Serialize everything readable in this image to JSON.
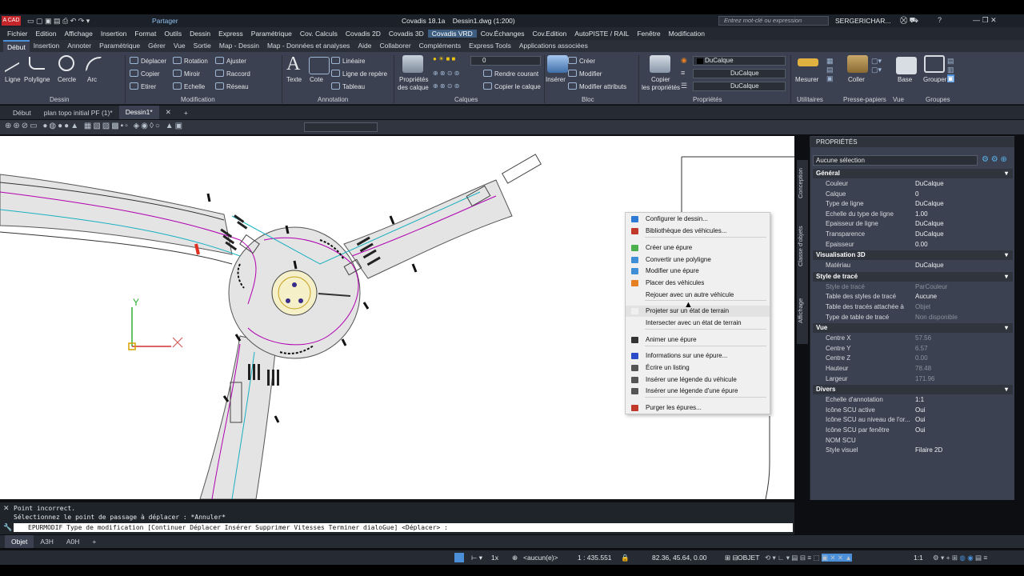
{
  "title": {
    "app_badge": "A CAD",
    "share": "Partager",
    "doc_title": "Covadis 18.1a    Dessin1.dwg (1:200)",
    "search_placeholder": "Entrez mot-clé ou expression",
    "user": "SERGERICHAR..."
  },
  "menubar": [
    "Fichier",
    "Edition",
    "Affichage",
    "Insertion",
    "Format",
    "Outils",
    "Dessin",
    "Express",
    "Paramétrique",
    "Cov. Calculs",
    "Covadis 2D",
    "Covadis 3D",
    "Covadis VRD",
    "Cov.Échanges",
    "Cov.Edition",
    "AutoPISTE / RAIL",
    "Fenêtre",
    "Modification"
  ],
  "menubar_active": "Covadis VRD",
  "ribbon_tabs": [
    "Début",
    "Insertion",
    "Annoter",
    "Paramétrique",
    "Gérer",
    "Vue",
    "Sortie",
    "Map - Dessin",
    "Map - Données et analyses",
    "Aide",
    "Collaborer",
    "Compléments",
    "Express Tools",
    "Applications associées"
  ],
  "ribbon": {
    "draw": [
      "Ligne",
      "Polyligne",
      "Cercle",
      "Arc"
    ],
    "draw_group": "Dessin",
    "modify": [
      "Déplacer",
      "Rotation",
      "Ajuster",
      "Copier",
      "Miroir",
      "Raccord",
      "Etirer",
      "Echelle",
      "Réseau"
    ],
    "modify_group": "Modification",
    "annot": [
      "Texte",
      "Cote",
      "Linéaire",
      "Ligne de repère",
      "Tableau"
    ],
    "annot_group": "Annotation",
    "layers": [
      "Propriétés",
      "des calque",
      "Rendre courant",
      "Copier le calque"
    ],
    "layer_value": "0",
    "layers_group": "Calques",
    "block": [
      "Insérer",
      "Créer",
      "Modifier",
      "Modifier attributs"
    ],
    "block_group": "Bloc",
    "props": [
      "Copier",
      "les propriétés",
      "DuCalque",
      "DuCalque",
      "DuCalque"
    ],
    "props_group": "Propriétés",
    "util": [
      "Mesurer",
      "Coller",
      "Base",
      "Grouper"
    ],
    "util_groups": [
      "Utilitaires",
      "Presse-papiers",
      "Vue",
      "Groupes"
    ]
  },
  "doc_tabs": [
    "Début",
    "plan topo initial PF (1)*",
    "Dessin1*"
  ],
  "ucs": {
    "y": "Y"
  },
  "context_menu": [
    {
      "label": "Configurer le dessin...",
      "icon": "config-icon",
      "color": "#2e7bd6"
    },
    {
      "label": "Bibliothèque des véhicules...",
      "icon": "vehicle-library-icon",
      "color": "#c0392b"
    },
    {
      "label": "Créer une épure",
      "icon": "create-path-icon",
      "color": "#4caf50"
    },
    {
      "label": "Convertir une polyligne",
      "icon": "convert-polyline-icon",
      "color": "#3f8fd6"
    },
    {
      "label": "Modifier une épure",
      "icon": "modify-path-icon",
      "color": "#3f8fd6"
    },
    {
      "label": "Placer des véhicules",
      "icon": "place-vehicles-icon",
      "color": "#e67e22"
    },
    {
      "label": "Rejouer avec un autre véhicule",
      "icon": "replay-icon",
      "color": "#f0f0f0"
    },
    {
      "label": "Projeter sur un état de terrain",
      "icon": "project-icon",
      "color": "#f0f0f0"
    },
    {
      "label": "Intersecter avec un état de terrain",
      "icon": "intersect-icon",
      "color": "#f0f0f0"
    },
    {
      "label": "Animer une épure",
      "icon": "animate-icon",
      "color": "#333333"
    },
    {
      "label": "Informations sur une épure...",
      "icon": "info-icon",
      "color": "#2b4cc8"
    },
    {
      "label": "Écrire un listing",
      "icon": "listing-icon",
      "color": "#555555"
    },
    {
      "label": "Insérer une légende du véhicule",
      "icon": "vehicle-legend-icon",
      "color": "#555555"
    },
    {
      "label": "Insérer une légende d'une épure",
      "icon": "path-legend-icon",
      "color": "#555555"
    },
    {
      "label": "Purger les épures...",
      "icon": "purge-icon",
      "color": "#c0392b"
    }
  ],
  "properties": {
    "title": "PROPRIÉTÉS",
    "selection": "Aucune sélection",
    "side_tabs": [
      "Conception",
      "Classe d'objets",
      "Affichage"
    ],
    "sections": [
      {
        "name": "Général",
        "rows": [
          [
            "Couleur",
            "DuCalque"
          ],
          [
            "Calque",
            "0"
          ],
          [
            "Type de ligne",
            "DuCalque"
          ],
          [
            "Echelle du type de ligne",
            "1.00"
          ],
          [
            "Epaisseur de ligne",
            "DuCalque"
          ],
          [
            "Transparence",
            "DuCalque"
          ],
          [
            "Epaisseur",
            "0.00"
          ]
        ]
      },
      {
        "name": "Visualisation 3D",
        "rows": [
          [
            "Matériau",
            "DuCalque"
          ]
        ]
      },
      {
        "name": "Style de tracé",
        "rows": [
          [
            "Style de tracé",
            "ParCouleur"
          ],
          [
            "Table des styles de tracé",
            "Aucune"
          ],
          [
            "Table des tracés attachée à",
            "Objet"
          ],
          [
            "Type de table de tracé",
            "Non disponible"
          ]
        ]
      },
      {
        "name": "Vue",
        "rows": [
          [
            "Centre X",
            "57.56"
          ],
          [
            "Centre Y",
            "6.57"
          ],
          [
            "Centre Z",
            "0.00"
          ],
          [
            "Hauteur",
            "78.48"
          ],
          [
            "Largeur",
            "171.96"
          ]
        ]
      },
      {
        "name": "Divers",
        "rows": [
          [
            "Echelle d'annotation",
            "1:1"
          ],
          [
            "Icône SCU active",
            "Oui"
          ],
          [
            "Icône SCU au niveau de l'or...",
            "Oui"
          ],
          [
            "Icône SCU par fenêtre",
            "Oui"
          ],
          [
            "NOM SCU",
            ""
          ],
          [
            "Style visuel",
            "Filaire 2D"
          ]
        ]
      }
    ]
  },
  "command": {
    "line1": "Point incorrect.",
    "line2": "Sélectionnez le point de passage à déplacer : *Annuler*",
    "input": "EPURMODIF Type de modification [Continuer Déplacer Insérer Supprimer Vitesses Terminer dialoGue] <Déplacer> :"
  },
  "layout_tabs": [
    "Objet",
    "A3H",
    "A0H"
  ],
  "status": {
    "scale_mode": "1x",
    "annot": "<aucun(e)>",
    "zoom": "1 : 435.551",
    "coords": "82.36, 45.64, 0.00",
    "mode": "OBJET",
    "ratio": "1:1"
  }
}
